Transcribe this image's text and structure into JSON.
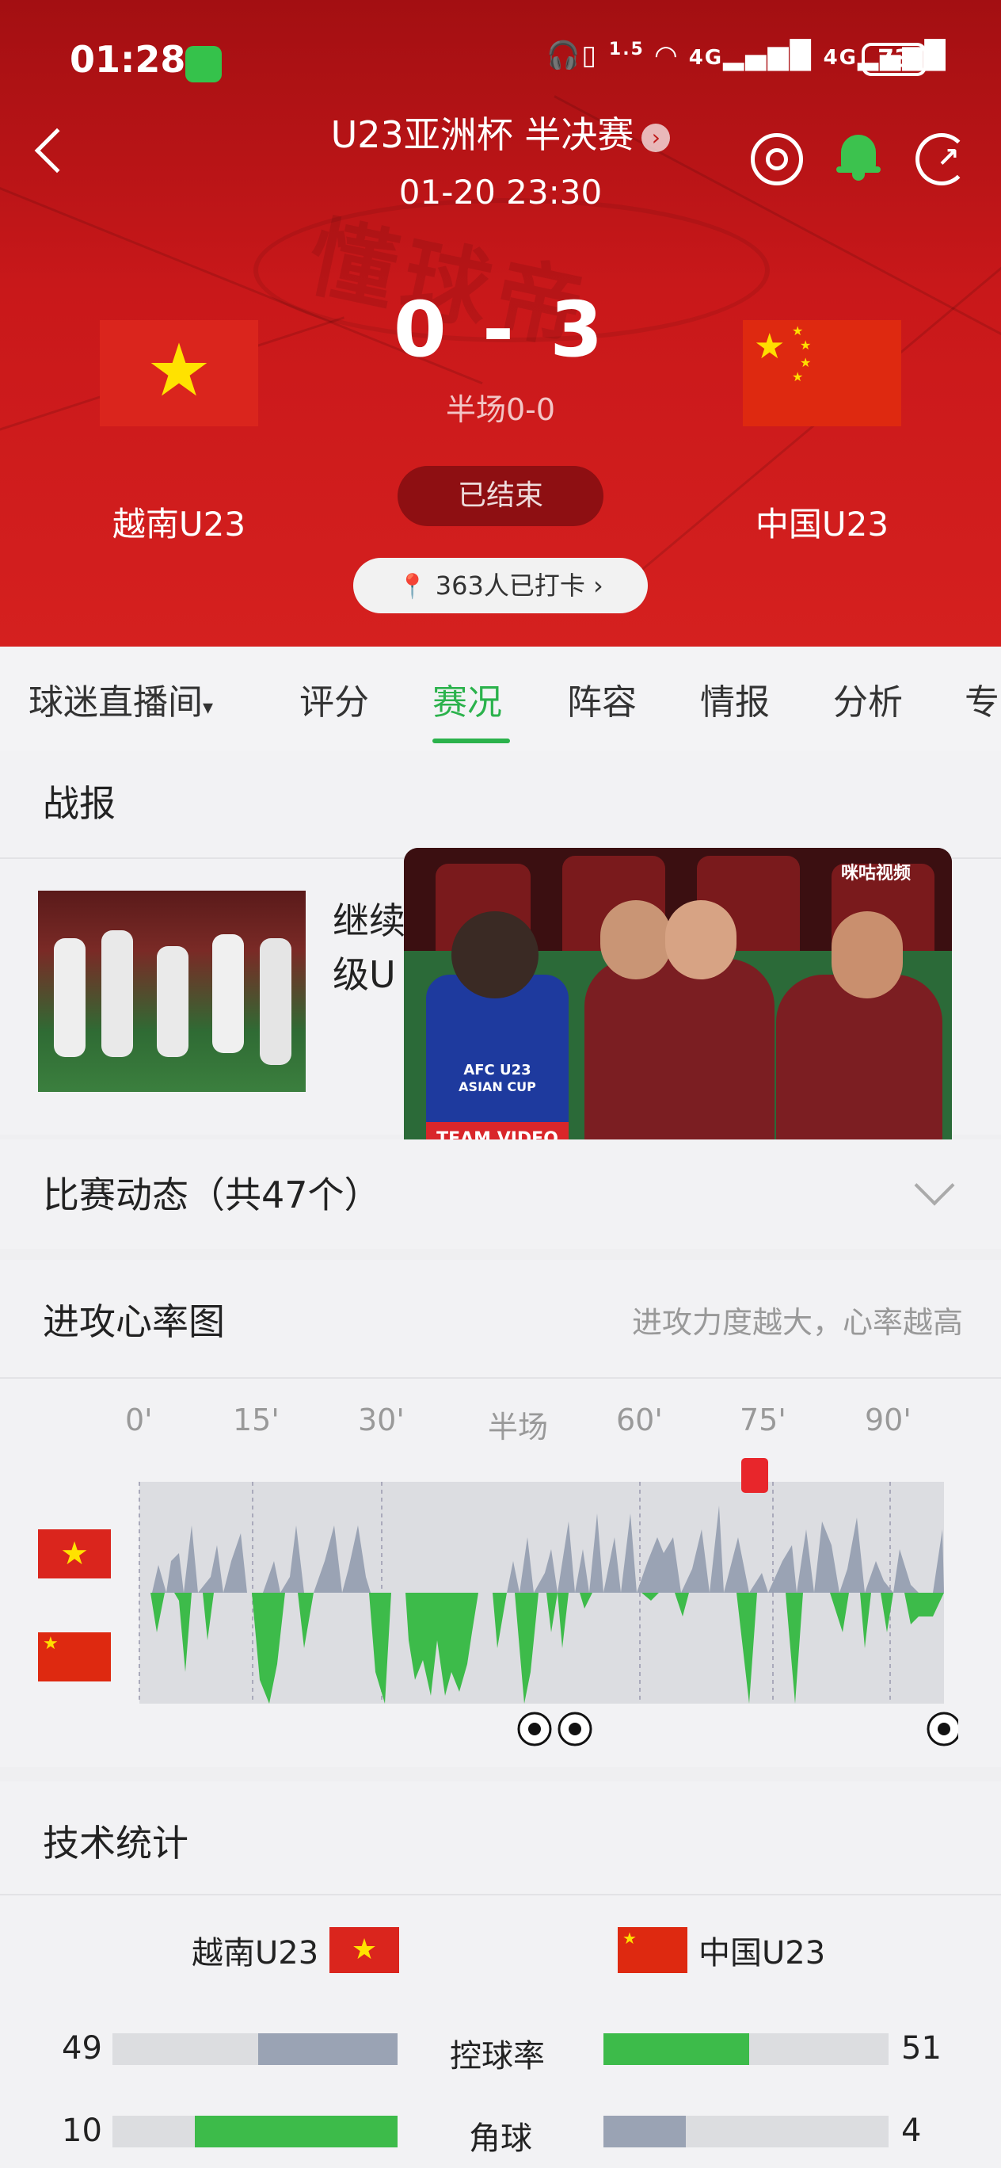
{
  "status_bar": {
    "time": "01:28",
    "signal_text": "1.5",
    "network_1": "4G",
    "network_2": "4G",
    "battery": "73"
  },
  "header": {
    "title": "U23亚洲杯 半决赛",
    "datetime": "01-20 23:30",
    "watermark": "懂球帝",
    "score": "0 - 3",
    "half_score": "半场0-0",
    "status": "已结束",
    "home_team": "越南U23",
    "away_team": "中国U23",
    "checkin": "363人已打卡"
  },
  "tabs": [
    "球迷直播间",
    "评分",
    "赛况",
    "阵容",
    "情报",
    "分析",
    "专"
  ],
  "active_tab": "赛况",
  "report": {
    "section_title": "战报",
    "headline_line1": "继续",
    "headline_line2": "级U",
    "video_logo": "咪咕视频",
    "video_text_1": "AFC U23",
    "video_text_2": "ASIAN CUP",
    "video_text_3": "TEAM VIDEO"
  },
  "events": {
    "label": "比赛动态（共47个）"
  },
  "heartbeat": {
    "title": "进攻心率图",
    "hint": "进攻力度越大，心率越高",
    "ticks": [
      "0'",
      "15'",
      "30'",
      "半场",
      "60'",
      "75'",
      "90'"
    ]
  },
  "tech_stats": {
    "title": "技术统计",
    "home": "越南U23",
    "away": "中国U23",
    "rows": [
      {
        "label": "控球率",
        "home": "49",
        "away": "51",
        "home_pct": 0.49,
        "away_pct": 0.51
      },
      {
        "label": "角球",
        "home": "10",
        "away": "4",
        "home_pct": 0.71,
        "away_pct": 0.29
      }
    ]
  },
  "colors": {
    "accent_green": "#2bb24c",
    "header_red": "#c9181a",
    "gray_bar": "#9aa3b4"
  }
}
